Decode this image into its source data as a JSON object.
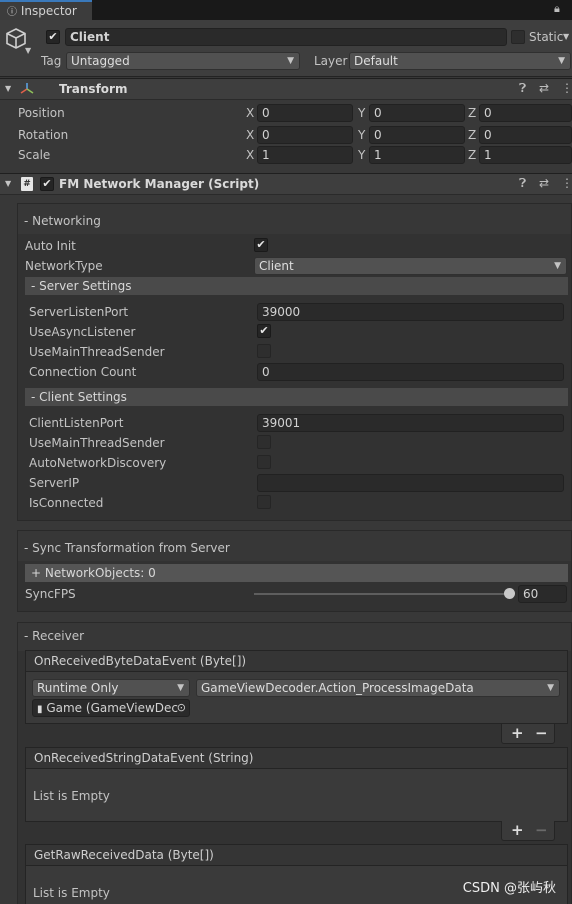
{
  "tab": {
    "title": "Inspector"
  },
  "object": {
    "name": "Client",
    "active": true,
    "static_label": "Static",
    "tag_label": "Tag",
    "tag_value": "Untagged",
    "layer_label": "Layer",
    "layer_value": "Default"
  },
  "transform": {
    "title": "Transform",
    "rows": [
      {
        "label": "Position",
        "x": "0",
        "y": "0",
        "z": "0"
      },
      {
        "label": "Rotation",
        "x": "0",
        "y": "0",
        "z": "0"
      },
      {
        "label": "Scale",
        "x": "1",
        "y": "1",
        "z": "1"
      }
    ],
    "axis_x": "X",
    "axis_y": "Y",
    "axis_z": "Z"
  },
  "script": {
    "title": "FM Network Manager (Script)",
    "networking": {
      "header": "- Networking",
      "auto_init_label": "Auto Init",
      "auto_init": true,
      "network_type_label": "NetworkType",
      "network_type_value": "Client",
      "server": {
        "header": "- Server Settings",
        "listen_port_label": "ServerListenPort",
        "listen_port": "39000",
        "async_listener_label": "UseAsyncListener",
        "async_listener": true,
        "main_thread_label": "UseMainThreadSender",
        "main_thread": false,
        "conn_count_label": "Connection Count",
        "conn_count": "0"
      },
      "client": {
        "header": "- Client Settings",
        "listen_port_label": "ClientListenPort",
        "listen_port": "39001",
        "main_thread_label": "UseMainThreadSender",
        "main_thread": false,
        "discovery_label": "AutoNetworkDiscovery",
        "discovery": false,
        "server_ip_label": "ServerIP",
        "server_ip": "",
        "connected_label": "IsConnected",
        "connected": false
      }
    },
    "sync": {
      "header": "- Sync Transformation from Server",
      "network_objects": "+ NetworkObjects: 0",
      "fps_label": "SyncFPS",
      "fps_value": "60",
      "fps_fraction": 1.0
    },
    "receiver": {
      "header": "- Receiver",
      "byte_event": {
        "title": "OnReceivedByteDataEvent (Byte[])",
        "runtime": "Runtime Only",
        "function": "GameViewDecoder.Action_ProcessImageData",
        "object": "Game (GameViewDec"
      },
      "string_event": {
        "title": "OnReceivedStringDataEvent (String)",
        "empty": "List is Empty"
      },
      "raw_event": {
        "title": "GetRawReceivedData (Byte[])",
        "empty": "List is Empty"
      }
    }
  },
  "watermark": "CSDN @张屿秋",
  "colors": {
    "accent": "#3a79bb",
    "background": "#383838"
  }
}
